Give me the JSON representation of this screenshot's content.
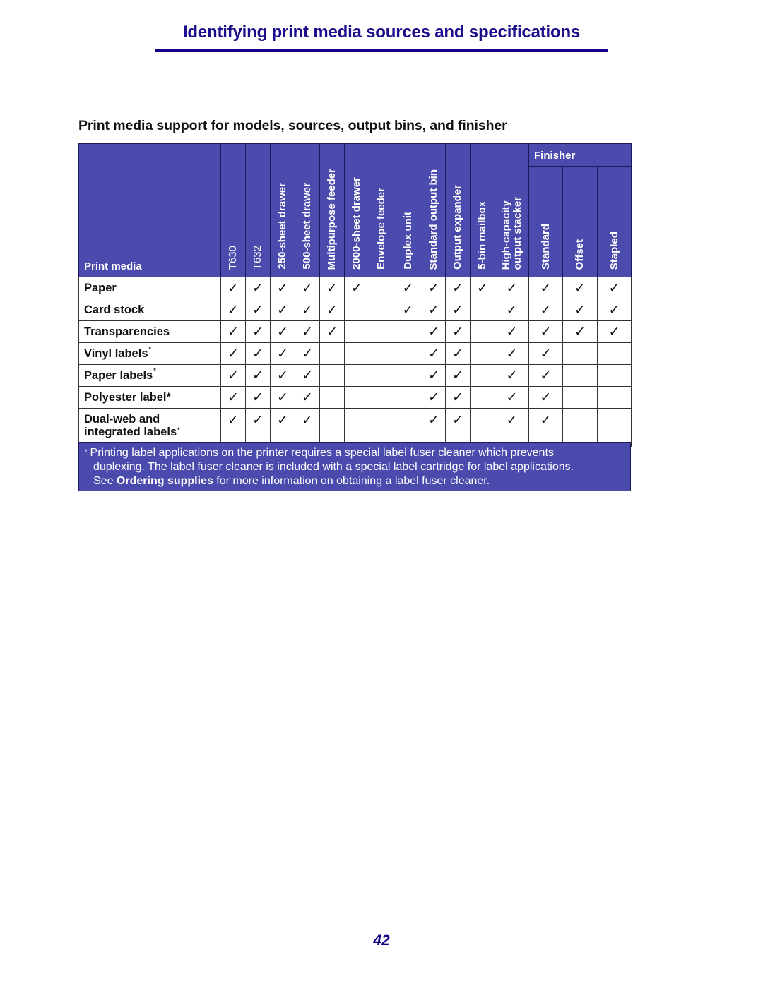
{
  "header": {
    "title": "Identifying print media sources and specifications"
  },
  "section": {
    "title": "Print media support for models, sources, output bins, and finisher"
  },
  "table": {
    "row_header": "Print media",
    "columns": [
      "T630",
      "T632",
      "250-sheet drawer",
      "500-sheet drawer",
      "Multipurpose feeder",
      "2000-sheet drawer",
      "Envelope feeder",
      "Duplex unit",
      "Standard output bin",
      "Output expander",
      "5-bin mailbox",
      "High-capacity",
      "output stacker"
    ],
    "finisher": {
      "label": "Finisher",
      "columns": [
        "Standard",
        "Offset",
        "Stapled"
      ]
    },
    "check_glyph": "✓",
    "rows": [
      {
        "label": "Paper",
        "sup": "",
        "cells": [
          "✓",
          "✓",
          "✓",
          "✓",
          "✓",
          "✓",
          "",
          "✓",
          "✓",
          "✓",
          "✓",
          "✓",
          "✓",
          "✓",
          "✓"
        ]
      },
      {
        "label": "Card stock",
        "sup": "",
        "cells": [
          "✓",
          "✓",
          "✓",
          "✓",
          "✓",
          "",
          "",
          "✓",
          "✓",
          "✓",
          "",
          "✓",
          "✓",
          "✓",
          "✓"
        ]
      },
      {
        "label": "Transparencies",
        "sup": "",
        "cells": [
          "✓",
          "✓",
          "✓",
          "✓",
          "✓",
          "",
          "",
          "",
          "✓",
          "✓",
          "",
          "✓",
          "✓",
          "✓",
          "✓"
        ]
      },
      {
        "label": "Vinyl labels",
        "sup": "*",
        "cells": [
          "✓",
          "✓",
          "✓",
          "✓",
          "",
          "",
          "",
          "",
          "✓",
          "✓",
          "",
          "✓",
          "✓",
          "",
          ""
        ]
      },
      {
        "label": "Paper labels",
        "sup": "*",
        "cells": [
          "✓",
          "✓",
          "✓",
          "✓",
          "",
          "",
          "",
          "",
          "✓",
          "✓",
          "",
          "✓",
          "✓",
          "",
          ""
        ]
      },
      {
        "label": "Polyester label*",
        "sup": "",
        "cells": [
          "✓",
          "✓",
          "✓",
          "✓",
          "",
          "",
          "",
          "",
          "✓",
          "✓",
          "",
          "✓",
          "✓",
          "",
          ""
        ]
      },
      {
        "label_line1": "Dual-web and",
        "label_line2": "integrated labels",
        "sup": "*",
        "cells": [
          "✓",
          "✓",
          "✓",
          "✓",
          "",
          "",
          "",
          "",
          "✓",
          "✓",
          "",
          "✓",
          "✓",
          "",
          ""
        ]
      }
    ]
  },
  "footnote": {
    "marker": "*",
    "line1": "Printing label applications on the printer requires a special label fuser cleaner which prevents",
    "line2": "duplexing. The label fuser cleaner is included with a special label cartridge for label applications.",
    "line3_prefix": "See ",
    "line3_link": "Ordering supplies",
    "line3_suffix": " for more information on obtaining a label fuser cleaner."
  },
  "footer": {
    "page_number": "42"
  }
}
